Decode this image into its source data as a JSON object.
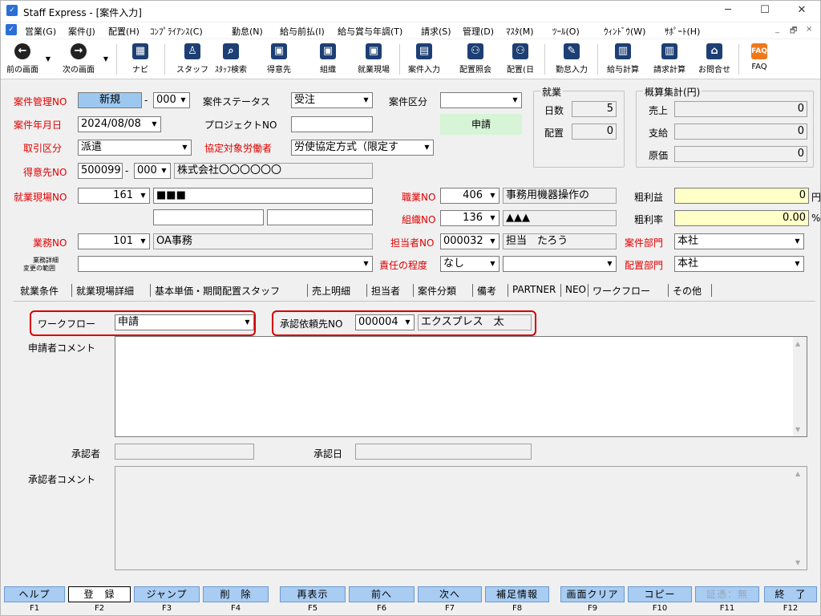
{
  "window": {
    "title": "Staff Express - [案件入力]",
    "minimize": "─",
    "maximize": "☐",
    "close": "✕"
  },
  "menu": {
    "items": [
      "営業(G)",
      "案件(J)",
      "配置(H)",
      "ｺﾝﾌﾟﾗｲｱﾝｽ(C)",
      "勤怠(N)",
      "給与前払(I)",
      "給与賞与年調(T)",
      "請求(S)",
      "管理(D)",
      "ﾏｽﾀ(M)",
      "ﾂｰﾙ(O)",
      "ｳｨﾝﾄﾞｳ(W)",
      "ｻﾎﾟｰﾄ(H)"
    ],
    "mdi_min": "_",
    "mdi_restore": "🗗",
    "mdi_close": "×"
  },
  "toolbar": {
    "back": "前の画面",
    "forward": "次の画面",
    "navi": "ナビ",
    "staff": "スタッフ",
    "staff_search": "ｽﾀｯﾌ検索",
    "customer": "得意先",
    "org": "組織",
    "site": "就業現場",
    "case_input": "案件入力",
    "placement_inquiry": "配置照会",
    "placement_day": "配置(日",
    "attendance": "勤怠入力",
    "payroll": "給与計算",
    "billing": "請求計算",
    "inquiry": "お問合せ",
    "faq": "FAQ"
  },
  "form": {
    "case_no_label": "案件管理NO",
    "case_no_value": "新規",
    "case_no_sep": "-",
    "case_no_sub": "000",
    "status_label": "案件ステータス",
    "status_value": "受注",
    "category_label": "案件区分",
    "category_value": "",
    "date_label": "案件年月日",
    "date_value": "2024/08/08",
    "project_label": "プロジェクトNO",
    "project_value": "",
    "apply_label": "申請",
    "trade_label": "取引区分",
    "trade_value": "派遣",
    "labor_label": "協定対象労働者",
    "labor_value": "労使協定方式（限定す",
    "customer_label": "得意先NO",
    "customer_no": "500099",
    "customer_sep": "-",
    "customer_sub": "000",
    "customer_name": "株式会社〇〇〇〇〇〇",
    "site_label": "就業現場NO",
    "site_no": "161",
    "site_name": "■■■",
    "site_extra1": "",
    "site_extra2": "",
    "job_label": "職業NO",
    "job_no": "406",
    "job_name": "事務用機器操作の",
    "org_label": "組織NO",
    "org_no": "136",
    "org_name": "▲▲▲",
    "staff_label": "担当者NO",
    "staff_no": "000032",
    "staff_name": "担当　たろう",
    "work_label": "業務NO",
    "work_no": "101",
    "work_name": "OA事務",
    "work_detail_label1": "業務詳細",
    "work_detail_label2": "変更の範囲",
    "work_detail_value": "",
    "resp_label": "責任の程度",
    "resp_value": "なし",
    "resp_value2": "",
    "dept_label": "案件部門",
    "dept_value": "本社",
    "place_dept_label": "配置部門",
    "place_dept_value": "本社",
    "gross_label": "粗利益",
    "gross_value": "0",
    "gross_unit": "円",
    "rate_label": "粗利率",
    "rate_value": "0.00",
    "rate_unit": "%"
  },
  "work_group": {
    "title": "就業",
    "days_label": "日数",
    "days_value": "5",
    "place_label": "配置",
    "place_value": "0"
  },
  "summary_group": {
    "title": "概算集計(円)",
    "sales_label": "売上",
    "sales_value": "0",
    "pay_label": "支給",
    "pay_value": "0",
    "cost_label": "原価",
    "cost_value": "0"
  },
  "tabs": [
    "就業条件",
    "就業現場詳細",
    "基本単価・期間配置スタッフ",
    "売上明細",
    "担当者",
    "案件分類",
    "備考",
    "PARTNER",
    "NEO",
    "ワークフロー",
    "その他"
  ],
  "workflow": {
    "wf_label": "ワークフロー",
    "wf_value": "申請",
    "approver_req_label": "承認依頼先NO",
    "approver_req_no": "000004",
    "approver_req_name": "エクスプレス　太",
    "applicant_comment_label": "申請者コメント",
    "applicant_comment": "",
    "approver_label": "承認者",
    "approver_value": "",
    "approve_date_label": "承認日",
    "approve_date_value": "",
    "approver_comment_label": "承認者コメント",
    "approver_comment": ""
  },
  "fkeys": [
    {
      "label": "ヘルプ",
      "key": "F1"
    },
    {
      "label": "登　録",
      "key": "F2"
    },
    {
      "label": "ジャンプ",
      "key": "F3"
    },
    {
      "label": "削　除",
      "key": "F4"
    },
    {
      "label": "再表示",
      "key": "F5"
    },
    {
      "label": "前へ",
      "key": "F6"
    },
    {
      "label": "次へ",
      "key": "F7"
    },
    {
      "label": "補足情報",
      "key": "F8"
    },
    {
      "label": "画面クリア",
      "key": "F9"
    },
    {
      "label": "コピー",
      "key": "F10"
    },
    {
      "label": "証憑：無",
      "key": "F11"
    },
    {
      "label": "終　了",
      "key": "F12"
    }
  ]
}
